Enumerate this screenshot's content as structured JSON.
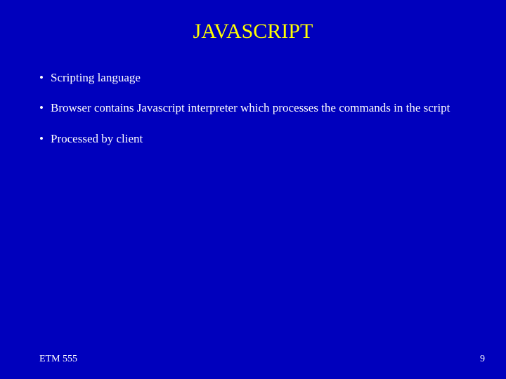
{
  "title": "JAVASCRIPT",
  "bullets": [
    "Scripting language",
    "Browser contains Javascript interpreter which processes the commands in the script",
    "Processed by client"
  ],
  "footer": {
    "left": "ETM 555",
    "right": "9"
  },
  "bullet_glyph": "•"
}
